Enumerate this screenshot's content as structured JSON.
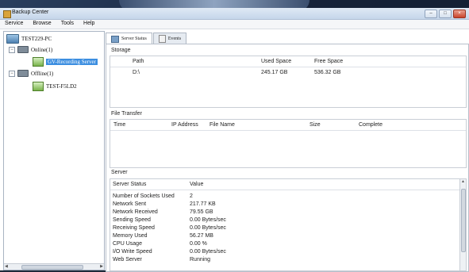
{
  "window": {
    "title": "Backup Center",
    "controls": [
      "–",
      "□",
      "×"
    ]
  },
  "menu": [
    "Service",
    "Browse",
    "Tools",
    "Help"
  ],
  "tree": {
    "root": "TEST229-PC",
    "online": "Online(1)",
    "online_server": "GV-Recording Server",
    "offline": "Offline(1)",
    "offline_server": "TEST-F5LD2"
  },
  "tabs": [
    "Server Status",
    "Events"
  ],
  "storage": {
    "label": "Storage",
    "headers": [
      "Path",
      "Used Space",
      "Free Space"
    ],
    "rows": [
      {
        "path": "D:\\",
        "used": "245.17 GB",
        "free": "536.32 GB"
      }
    ]
  },
  "file_transfer": {
    "label": "File Transfer",
    "headers": [
      "Time",
      "IP Address",
      "File Name",
      "Size",
      "Complete"
    ]
  },
  "server": {
    "label": "Server",
    "headers": [
      "Server Status",
      "Value"
    ],
    "rows": [
      {
        "name": "Number of Sockets Used",
        "value": "2"
      },
      {
        "name": "Network Sent",
        "value": "217.77 KB"
      },
      {
        "name": "Network Received",
        "value": "79.55 GB"
      },
      {
        "name": "Sending Speed",
        "value": "0.00 Bytes/sec"
      },
      {
        "name": "Receiving Speed",
        "value": "0.00 Bytes/sec"
      },
      {
        "name": "Memory Used",
        "value": "56.27 MB"
      },
      {
        "name": "CPU Usage",
        "value": "0.00 %"
      },
      {
        "name": "I/O Write Speed",
        "value": "0.00 Bytes/sec"
      },
      {
        "name": "Web Server",
        "value": "Running"
      }
    ]
  }
}
